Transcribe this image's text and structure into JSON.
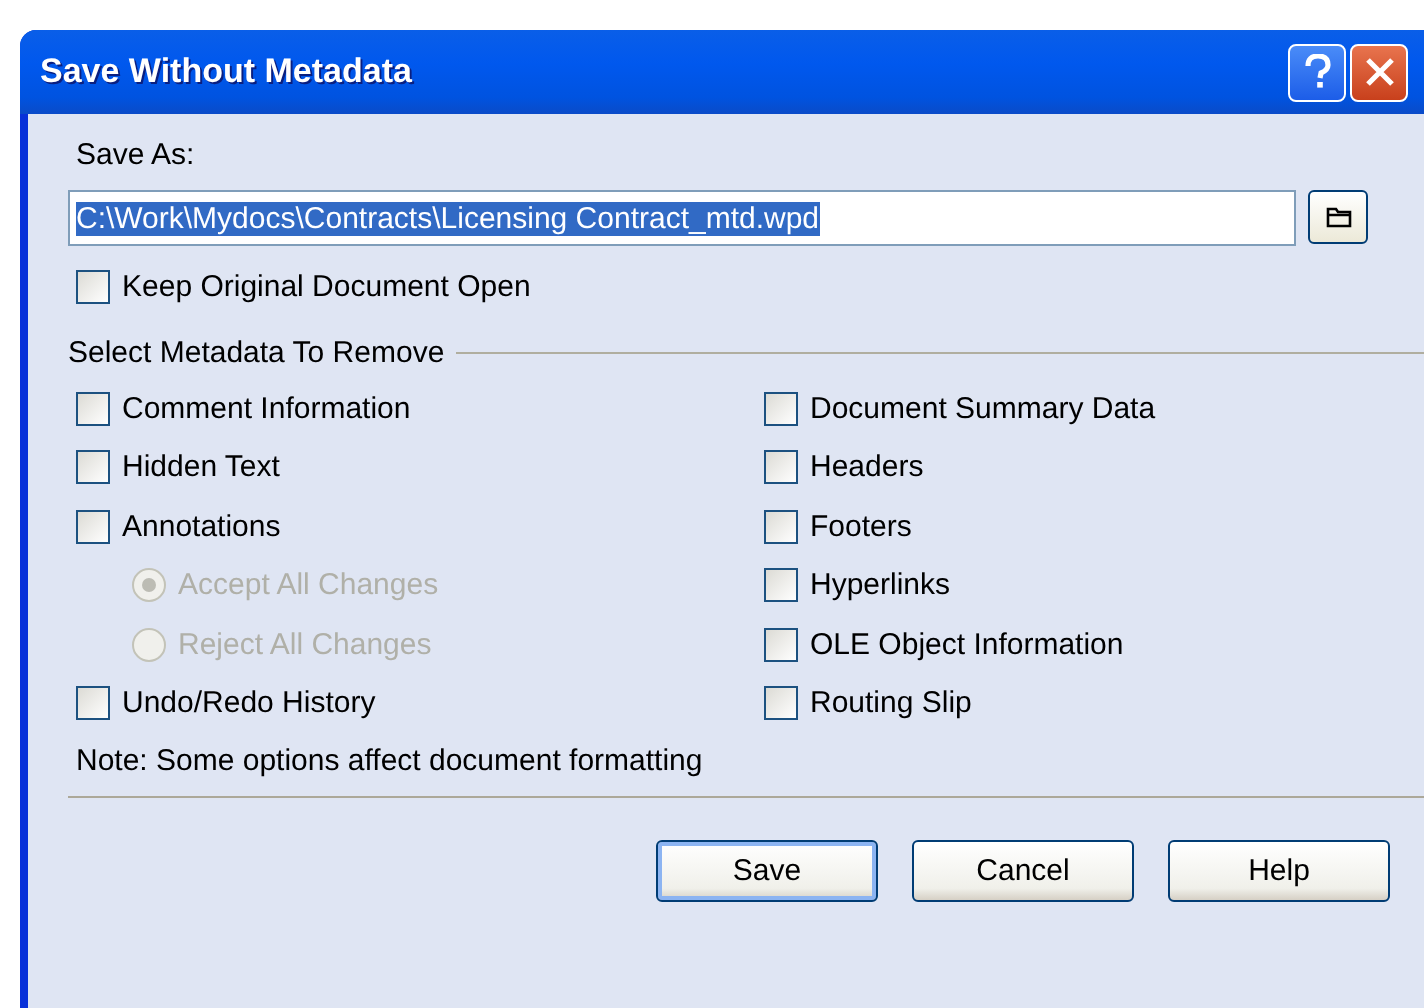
{
  "window": {
    "title": "Save Without Metadata"
  },
  "save_as": {
    "label": "Save As:",
    "value": "C:\\Work\\Mydocs\\Contracts\\Licensing Contract_mtd.wpd",
    "text_selected": true
  },
  "keep_open": {
    "label": "Keep Original Document Open",
    "checked": false
  },
  "group": {
    "title": "Select Metadata To Remove",
    "left": [
      {
        "kind": "checkbox",
        "label": "Comment Information",
        "checked": false,
        "disabled": false
      },
      {
        "kind": "checkbox",
        "label": "Hidden Text",
        "checked": false,
        "disabled": false
      },
      {
        "kind": "checkbox",
        "label": "Annotations",
        "checked": false,
        "disabled": false
      },
      {
        "kind": "radio",
        "label": "Accept All Changes",
        "selected": true,
        "disabled": true
      },
      {
        "kind": "radio",
        "label": "Reject All Changes",
        "selected": false,
        "disabled": true
      },
      {
        "kind": "checkbox",
        "label": "Undo/Redo History",
        "checked": false,
        "disabled": false
      }
    ],
    "right": [
      {
        "kind": "checkbox",
        "label": "Document Summary Data",
        "checked": false,
        "disabled": false
      },
      {
        "kind": "checkbox",
        "label": "Headers",
        "checked": false,
        "disabled": false
      },
      {
        "kind": "checkbox",
        "label": "Footers",
        "checked": false,
        "disabled": false
      },
      {
        "kind": "checkbox",
        "label": "Hyperlinks",
        "checked": false,
        "disabled": false
      },
      {
        "kind": "checkbox",
        "label": "OLE Object Information",
        "checked": false,
        "disabled": false
      },
      {
        "kind": "checkbox",
        "label": "Routing Slip",
        "checked": false,
        "disabled": false
      }
    ]
  },
  "note": "Note: Some options affect document formatting",
  "buttons": [
    {
      "label": "Save",
      "default": true
    },
    {
      "label": "Cancel",
      "default": false
    },
    {
      "label": "Help",
      "default": false
    }
  ]
}
